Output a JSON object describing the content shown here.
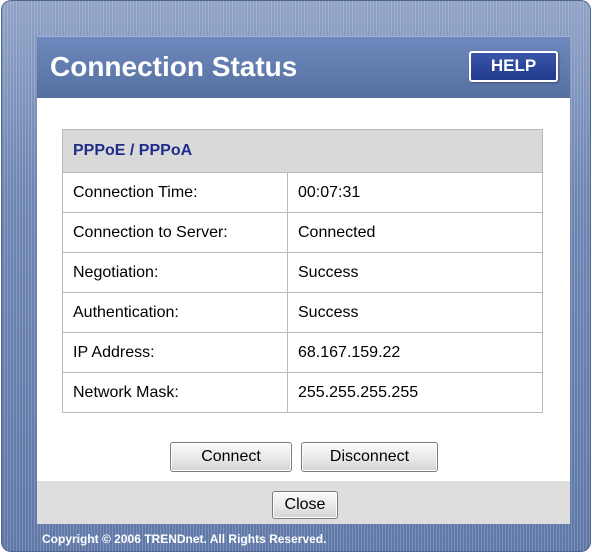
{
  "header": {
    "title": "Connection Status",
    "help_label": "HELP"
  },
  "table": {
    "heading": "PPPoE / PPPoA",
    "rows": [
      {
        "label": "Connection Time:",
        "value": "00:07:31"
      },
      {
        "label": "Connection to Server:",
        "value": "Connected"
      },
      {
        "label": "Negotiation:",
        "value": "Success"
      },
      {
        "label": "Authentication:",
        "value": "Success"
      },
      {
        "label": "IP Address:",
        "value": "68.167.159.22"
      },
      {
        "label": "Network Mask:",
        "value": "255.255.255.255"
      }
    ]
  },
  "actions": {
    "connect_label": "Connect",
    "disconnect_label": "Disconnect",
    "close_label": "Close"
  },
  "footer": {
    "copyright": "Copyright © 2006 TRENDnet. All Rights Reserved."
  },
  "colors": {
    "frame": "#6f86b3",
    "header": "#5f79aa",
    "help_button": "#2a449b",
    "table_heading_text": "#1f2d8a",
    "table_heading_bg": "#d9d9d9"
  }
}
